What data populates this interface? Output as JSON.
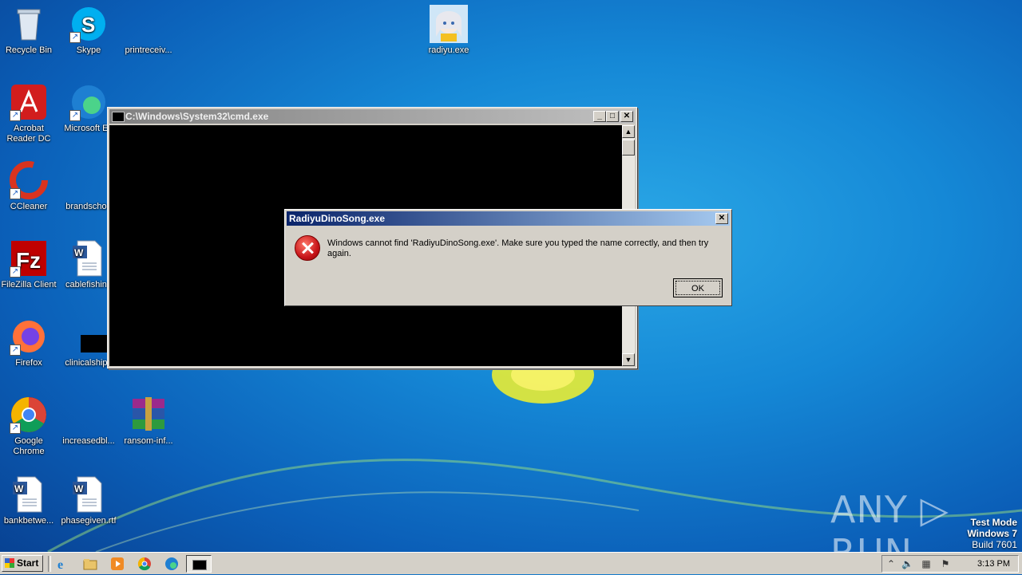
{
  "desktop": {
    "icons": [
      {
        "label": "Recycle Bin"
      },
      {
        "label": "Skype"
      },
      {
        "label": "printreceiv..."
      },
      {
        "label": "radiyu.exe"
      },
      {
        "label": "Acrobat Reader DC"
      },
      {
        "label": "Microsoft Ed"
      },
      {
        "label": "CCleaner"
      },
      {
        "label": "brandschoo"
      },
      {
        "label": "FileZilla Client"
      },
      {
        "label": "cablefishing"
      },
      {
        "label": "Firefox"
      },
      {
        "label": "clinicalshipp"
      },
      {
        "label": "Google Chrome"
      },
      {
        "label": "increasedbl..."
      },
      {
        "label": "ransom-inf..."
      },
      {
        "label": "bankbetwe..."
      },
      {
        "label": "phasegiven.rtf"
      }
    ]
  },
  "cmd_window": {
    "title": "C:\\Windows\\System32\\cmd.exe",
    "minimize": "_",
    "maximize": "□",
    "close": "✕"
  },
  "error_dialog": {
    "title": "RadiyuDinoSong.exe",
    "message": "Windows cannot find 'RadiyuDinoSong.exe'. Make sure you typed the name correctly, and then try again.",
    "ok_label": "OK",
    "close": "✕"
  },
  "watermark": {
    "text": "ANY ▷ RUN"
  },
  "system_info": {
    "line1": "Test Mode",
    "line2": "Windows 7",
    "line3": "Build 7601"
  },
  "taskbar": {
    "start_label": "Start",
    "clock": "3:13 PM",
    "quick_launch": [
      "internet-explorer-icon",
      "folder-icon",
      "media-player-icon",
      "chrome-icon",
      "edge-icon"
    ]
  },
  "colors": {
    "desktop_blue": "#1588d6",
    "dialog_title": "#0a246a",
    "window_face": "#d4d0c8"
  }
}
